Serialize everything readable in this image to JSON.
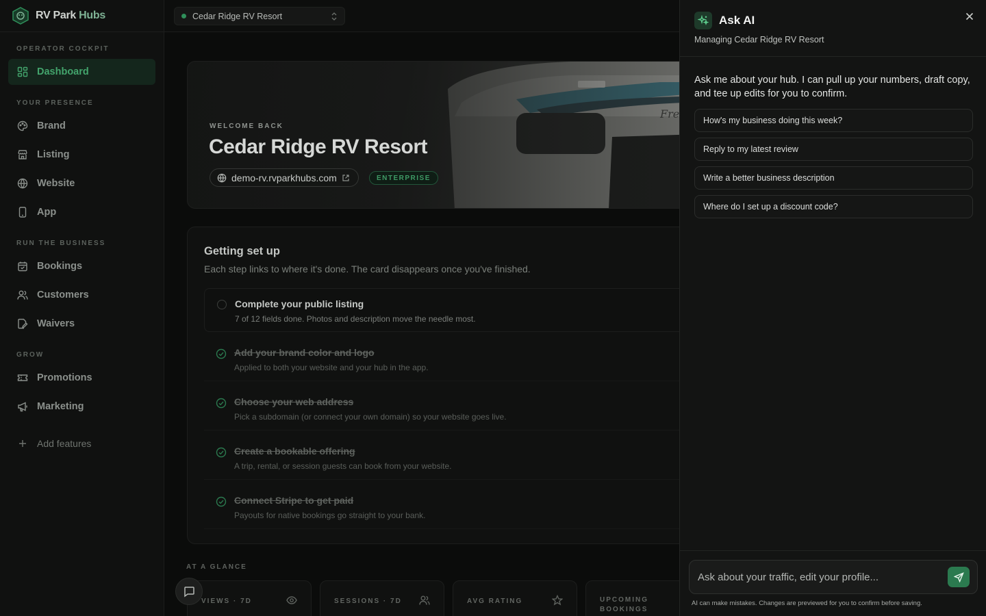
{
  "brand": {
    "name_part1": "RV Park ",
    "name_part2": "Hubs"
  },
  "topbar": {
    "selected_resort": "Cedar Ridge RV Resort"
  },
  "sidebar": {
    "sections": [
      {
        "label": "OPERATOR COCKPIT"
      },
      {
        "label": "YOUR PRESENCE"
      },
      {
        "label": "RUN THE BUSINESS"
      },
      {
        "label": "GROW"
      }
    ],
    "items": [
      {
        "label": "Dashboard",
        "icon": "dashboard-icon"
      },
      {
        "label": "Brand",
        "icon": "palette-icon"
      },
      {
        "label": "Listing",
        "icon": "store-icon"
      },
      {
        "label": "Website",
        "icon": "globe-icon"
      },
      {
        "label": "App",
        "icon": "phone-icon"
      },
      {
        "label": "Bookings",
        "icon": "calendar-icon"
      },
      {
        "label": "Customers",
        "icon": "users-icon"
      },
      {
        "label": "Waivers",
        "icon": "document-sign-icon"
      },
      {
        "label": "Promotions",
        "icon": "ticket-icon"
      },
      {
        "label": "Marketing",
        "icon": "megaphone-icon"
      },
      {
        "label": "Add features",
        "icon": "plus-icon"
      }
    ]
  },
  "hero": {
    "eyebrow": "WELCOME BACK",
    "title": "Cedar Ridge RV Resort",
    "domain": "demo-rv.rvparkhubs.com",
    "plan_badge": "ENTERPRISE"
  },
  "setup": {
    "title": "Getting set up",
    "subtitle": "Each step links to where it's done. The card disappears once you've finished.",
    "steps": [
      {
        "title": "Complete your public listing",
        "desc": "7 of 12 fields done. Photos and description move the needle most.",
        "done": false
      },
      {
        "title": "Add your brand color and logo",
        "desc": "Applied to both your website and your hub in the app.",
        "done": true
      },
      {
        "title": "Choose your web address",
        "desc": "Pick a subdomain (or connect your own domain) so your website goes live.",
        "done": true
      },
      {
        "title": "Create a bookable offering",
        "desc": "A trip, rental, or session guests can book from your website.",
        "done": true
      },
      {
        "title": "Connect Stripe to get paid",
        "desc": "Payouts for native bookings go straight to your bank.",
        "done": true
      }
    ]
  },
  "glance": {
    "label": "AT A GLANCE",
    "stats": [
      {
        "label": "VIEWS · 7D",
        "icon": "eye-icon"
      },
      {
        "label": "SESSIONS · 7D",
        "icon": "users-icon"
      },
      {
        "label": "AVG RATING",
        "icon": "star-icon"
      },
      {
        "label_line1": "UPCOMING",
        "label_line2": "BOOKINGS"
      }
    ]
  },
  "ai_panel": {
    "title": "Ask AI",
    "subtitle": "Managing Cedar Ridge RV Resort",
    "intro": "Ask me about your hub. I can pull up your numbers, draft copy, and tee up edits for you to confirm.",
    "suggestions": [
      "How's my business doing this week?",
      "Reply to my latest review",
      "Write a better business description",
      "Where do I set up a discount code?"
    ],
    "input_placeholder": "Ask about your traffic, edit your profile...",
    "input_value": "",
    "disclaimer": "AI can make mistakes. Changes are previewed for you to confirm before saving."
  },
  "colors": {
    "accent": "#2b7a4f",
    "accent_text": "#43a46c",
    "panel_bg": "#131413",
    "page_bg": "#0b0c0b"
  }
}
